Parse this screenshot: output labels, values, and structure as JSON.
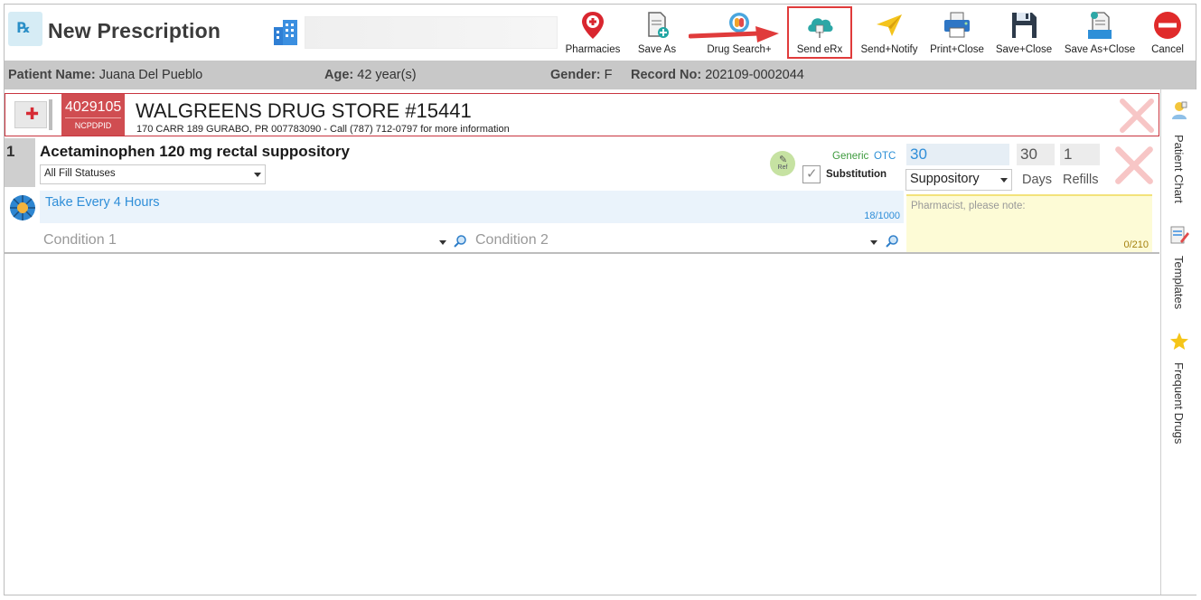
{
  "window": {
    "title": "New Prescription"
  },
  "toolbar": {
    "buttons": [
      {
        "id": "pharmacies",
        "label": "Pharmacies",
        "icon": "map-pin-icon"
      },
      {
        "id": "save_as",
        "label": "Save As",
        "icon": "document-add-icon"
      },
      {
        "id": "drug_search",
        "label": "Drug Search+",
        "icon": "pills-icon"
      },
      {
        "id": "send_erx",
        "label": "Send eRx",
        "icon": "cloud-upload-icon"
      },
      {
        "id": "send_notify",
        "label": "Send+Notify",
        "icon": "paper-plane-icon"
      },
      {
        "id": "print_close",
        "label": "Print+Close",
        "icon": "printer-icon"
      },
      {
        "id": "save_close",
        "label": "Save+Close",
        "icon": "floppy-icon"
      },
      {
        "id": "save_as_close",
        "label": "Save As+Close",
        "icon": "document-save-icon"
      },
      {
        "id": "cancel",
        "label": "Cancel",
        "icon": "cancel-icon"
      }
    ]
  },
  "patient": {
    "name_label": "Patient Name:",
    "name": "Juana Del Pueblo",
    "age_label": "Age:",
    "age": "42 year(s)",
    "gender_label": "Gender:",
    "gender": "F",
    "record_label": "Record No:",
    "record": "202109-0002044"
  },
  "pharmacy": {
    "ncpdp_id": "4029105",
    "ncpdp_label": "NCPDPID",
    "name": "WALGREENS DRUG STORE #15441",
    "address": "170 CARR 189 GURABO, PR 007783090 - Call (787) 712-0797 for more information"
  },
  "prescription": {
    "index": "1",
    "drug_name": "Acetaminophen 120 mg rectal suppository",
    "fill_status": "All Fill Statuses",
    "ref_label": "Ref",
    "generic_label": "Generic",
    "otc_label": "OTC",
    "substitution_label": "Substitution",
    "quantity": "30",
    "unit": "Suppository",
    "days": "30",
    "days_label": "Days",
    "refills": "1",
    "refills_label": "Refills",
    "sig": "Take Every 4 Hours",
    "sig_count": "18/1000",
    "note_placeholder": "Pharmacist, please note:",
    "note_count": "0/210",
    "condition1_placeholder": "Condition 1",
    "condition2_placeholder": "Condition 2"
  },
  "side_panel": {
    "items": [
      {
        "label": "Patient Chart",
        "icon": "patient-chart-icon"
      },
      {
        "label": "Templates",
        "icon": "templates-icon"
      },
      {
        "label": "Frequent Drugs",
        "icon": "star-icon"
      }
    ]
  },
  "colors": {
    "highlight": "#e03b3b",
    "pharmacy_accent": "#d04d51",
    "link_blue": "#2f8ed8",
    "generic_green": "#3d9a3d",
    "patient_bar": "#c8c8c8"
  }
}
